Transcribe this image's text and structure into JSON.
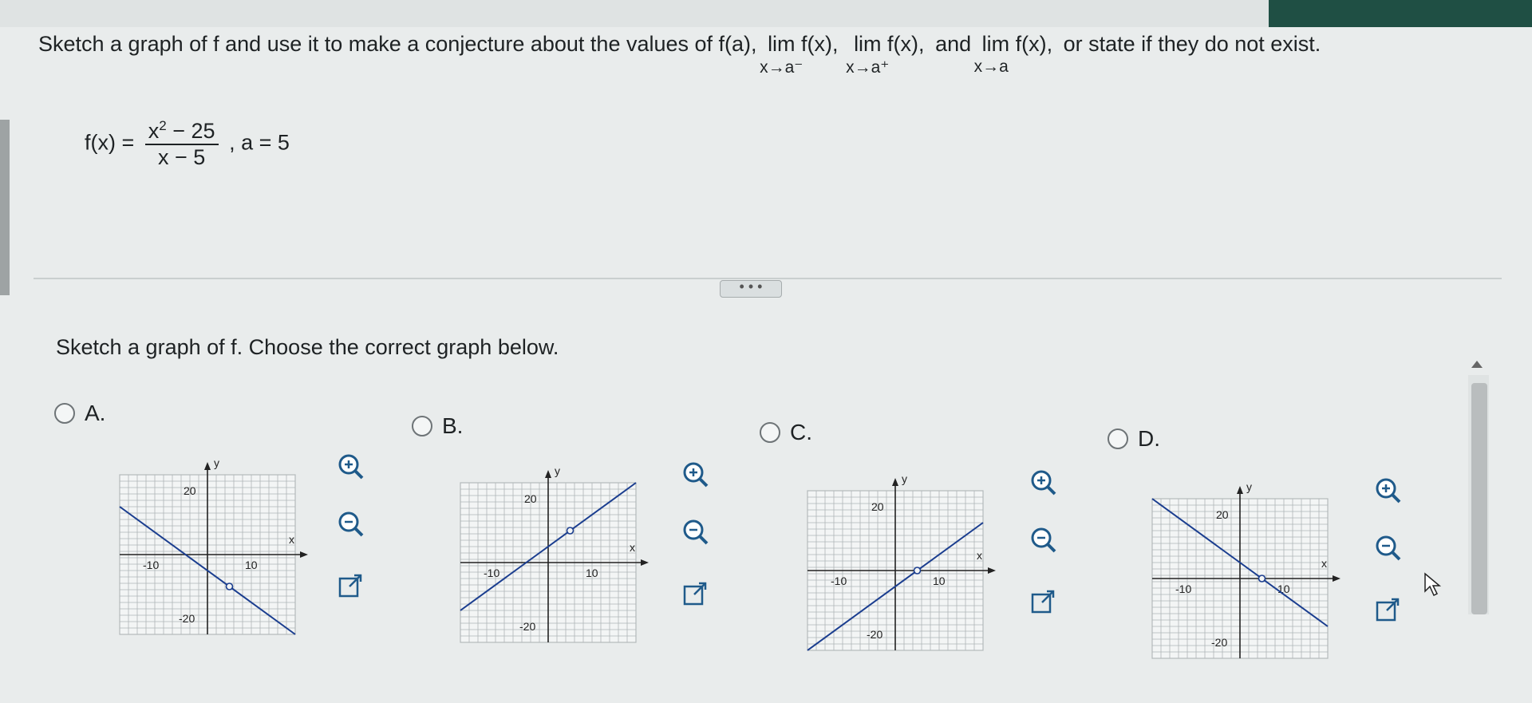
{
  "question": {
    "intro": "Sketch a graph of f and use it to make a conjecture about the values of f(a),",
    "lim_left": "lim f(x),",
    "lim_left_sub": "x→a⁻",
    "lim_right": "lim f(x),",
    "lim_right_sub": "x→a⁺",
    "and_text": "and",
    "lim_both": "lim f(x),",
    "lim_both_sub": "x→a",
    "outro": "or state if they do not exist."
  },
  "function": {
    "lhs": "f(x) =",
    "numerator_base": "x",
    "numerator_exp": "2",
    "numerator_rest": "− 25",
    "denominator": "x − 5",
    "a_value": ", a = 5"
  },
  "expand_button": "• • •",
  "prompt": "Sketch a graph of f. Choose the correct graph below.",
  "options": [
    {
      "label": "A.",
      "slope": -1,
      "intercept": -5,
      "hole": [
        5,
        -10
      ]
    },
    {
      "label": "B.",
      "slope": 1,
      "intercept": 5,
      "hole": [
        5,
        10
      ]
    },
    {
      "label": "C.",
      "slope": 1,
      "intercept": -5,
      "hole": [
        5,
        0
      ]
    },
    {
      "label": "D.",
      "slope": -1,
      "intercept": 5,
      "hole": [
        5,
        0
      ]
    }
  ],
  "axis": {
    "x_label": "x",
    "y_label": "y",
    "tick_neg": "-10",
    "tick_pos": "10",
    "y_top": "20",
    "y_bottom": "-20"
  },
  "icons": {
    "zoom_in": "zoom-in-icon",
    "zoom_out": "zoom-out-icon",
    "popout": "popout-icon"
  }
}
